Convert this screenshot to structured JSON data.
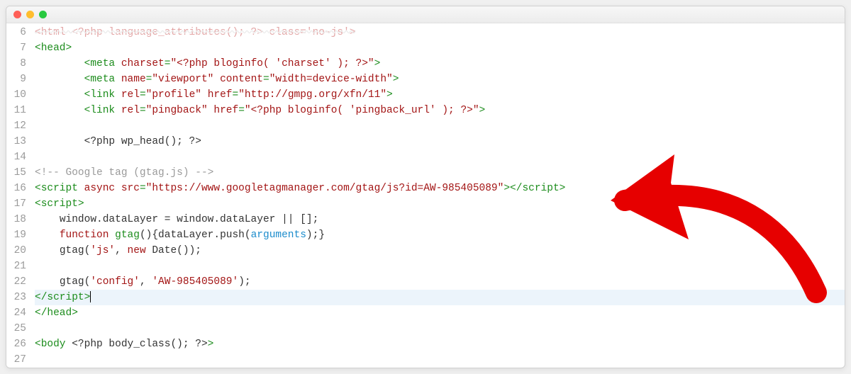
{
  "window": {
    "title": ""
  },
  "gutter_start": 6,
  "lines": [
    {
      "n": 6,
      "indent": 0,
      "raw": true,
      "html": "<span class='darkred' style='text-decoration: line-through wavy #ccc; opacity:.35'>&lt;html &lt;?php language_attributes(); ?&gt; class='no-js'&gt;</span>"
    },
    {
      "n": 7,
      "indent": 0,
      "tokens": [
        {
          "t": "<head>",
          "c": "tag"
        }
      ]
    },
    {
      "n": 8,
      "indent": 2,
      "tokens": [
        {
          "t": "<meta ",
          "c": "tag"
        },
        {
          "t": "charset",
          "c": "attr"
        },
        {
          "t": "=",
          "c": "tag"
        },
        {
          "t": "\"<?php bloginfo( 'charset' ); ?>\"",
          "c": "str"
        },
        {
          "t": ">",
          "c": "tag"
        }
      ]
    },
    {
      "n": 9,
      "indent": 2,
      "tokens": [
        {
          "t": "<meta ",
          "c": "tag"
        },
        {
          "t": "name",
          "c": "attr"
        },
        {
          "t": "=",
          "c": "tag"
        },
        {
          "t": "\"viewport\"",
          "c": "str"
        },
        {
          "t": " ",
          "c": ""
        },
        {
          "t": "content",
          "c": "attr"
        },
        {
          "t": "=",
          "c": "tag"
        },
        {
          "t": "\"width=device-width\"",
          "c": "str"
        },
        {
          "t": ">",
          "c": "tag"
        }
      ]
    },
    {
      "n": 10,
      "indent": 2,
      "tokens": [
        {
          "t": "<link ",
          "c": "tag"
        },
        {
          "t": "rel",
          "c": "attr"
        },
        {
          "t": "=",
          "c": "tag"
        },
        {
          "t": "\"profile\"",
          "c": "str"
        },
        {
          "t": " ",
          "c": ""
        },
        {
          "t": "href",
          "c": "attr"
        },
        {
          "t": "=",
          "c": "tag"
        },
        {
          "t": "\"http://gmpg.org/xfn/11\"",
          "c": "str"
        },
        {
          "t": ">",
          "c": "tag"
        }
      ]
    },
    {
      "n": 11,
      "indent": 2,
      "tokens": [
        {
          "t": "<link ",
          "c": "tag"
        },
        {
          "t": "rel",
          "c": "attr"
        },
        {
          "t": "=",
          "c": "tag"
        },
        {
          "t": "\"pingback\"",
          "c": "str"
        },
        {
          "t": " ",
          "c": ""
        },
        {
          "t": "href",
          "c": "attr"
        },
        {
          "t": "=",
          "c": "tag"
        },
        {
          "t": "\"<?php bloginfo( 'pingback_url' ); ?>\"",
          "c": "str"
        },
        {
          "t": ">",
          "c": "tag"
        }
      ]
    },
    {
      "n": 12,
      "indent": 0,
      "tokens": []
    },
    {
      "n": 13,
      "indent": 2,
      "tokens": [
        {
          "t": "<?php wp_head(); ?>",
          "c": "php"
        }
      ]
    },
    {
      "n": 14,
      "indent": 0,
      "tokens": []
    },
    {
      "n": 15,
      "indent": 0,
      "tokens": [
        {
          "t": "<!-- Google tag (gtag.js) -->",
          "c": "cmt"
        }
      ]
    },
    {
      "n": 16,
      "indent": 0,
      "tokens": [
        {
          "t": "<script ",
          "c": "tag"
        },
        {
          "t": "async ",
          "c": "attr"
        },
        {
          "t": "src",
          "c": "attr"
        },
        {
          "t": "=",
          "c": "tag"
        },
        {
          "t": "\"https://www.googletagmanager.com/gtag/js?id=AW-985405089\"",
          "c": "str"
        },
        {
          "t": "></script>",
          "c": "tag"
        }
      ]
    },
    {
      "n": 17,
      "indent": 0,
      "tokens": [
        {
          "t": "<script>",
          "c": "tag"
        }
      ]
    },
    {
      "n": 18,
      "indent": 1,
      "tokens": [
        {
          "t": "window.dataLayer = window.dataLayer || [];",
          "c": "php"
        }
      ]
    },
    {
      "n": 19,
      "indent": 1,
      "tokens": [
        {
          "t": "function ",
          "c": "kw"
        },
        {
          "t": "gtag",
          "c": "fn"
        },
        {
          "t": "(){dataLayer.push(",
          "c": "php"
        },
        {
          "t": "arguments",
          "c": "arg"
        },
        {
          "t": ");}",
          "c": "php"
        }
      ]
    },
    {
      "n": 20,
      "indent": 1,
      "tokens": [
        {
          "t": "gtag(",
          "c": "php"
        },
        {
          "t": "'js'",
          "c": "str"
        },
        {
          "t": ", ",
          "c": "php"
        },
        {
          "t": "new ",
          "c": "kw"
        },
        {
          "t": "Date());",
          "c": "php"
        }
      ]
    },
    {
      "n": 21,
      "indent": 0,
      "tokens": []
    },
    {
      "n": 22,
      "indent": 1,
      "tokens": [
        {
          "t": "gtag(",
          "c": "php"
        },
        {
          "t": "'config'",
          "c": "str"
        },
        {
          "t": ", ",
          "c": "php"
        },
        {
          "t": "'AW-985405089'",
          "c": "str"
        },
        {
          "t": ");",
          "c": "php"
        }
      ]
    },
    {
      "n": 23,
      "indent": 0,
      "current": true,
      "cursor": true,
      "tokens": [
        {
          "t": "</script>",
          "c": "tag"
        }
      ]
    },
    {
      "n": 24,
      "indent": 0,
      "tokens": [
        {
          "t": "</head>",
          "c": "tag"
        }
      ]
    },
    {
      "n": 25,
      "indent": 0,
      "tokens": []
    },
    {
      "n": 26,
      "indent": 0,
      "tokens": [
        {
          "t": "<body ",
          "c": "tag"
        },
        {
          "t": "<?php body_class(); ?>",
          "c": "php"
        },
        {
          "t": ">",
          "c": "tag"
        }
      ]
    },
    {
      "n": 27,
      "indent": 0,
      "tokens": []
    }
  ]
}
